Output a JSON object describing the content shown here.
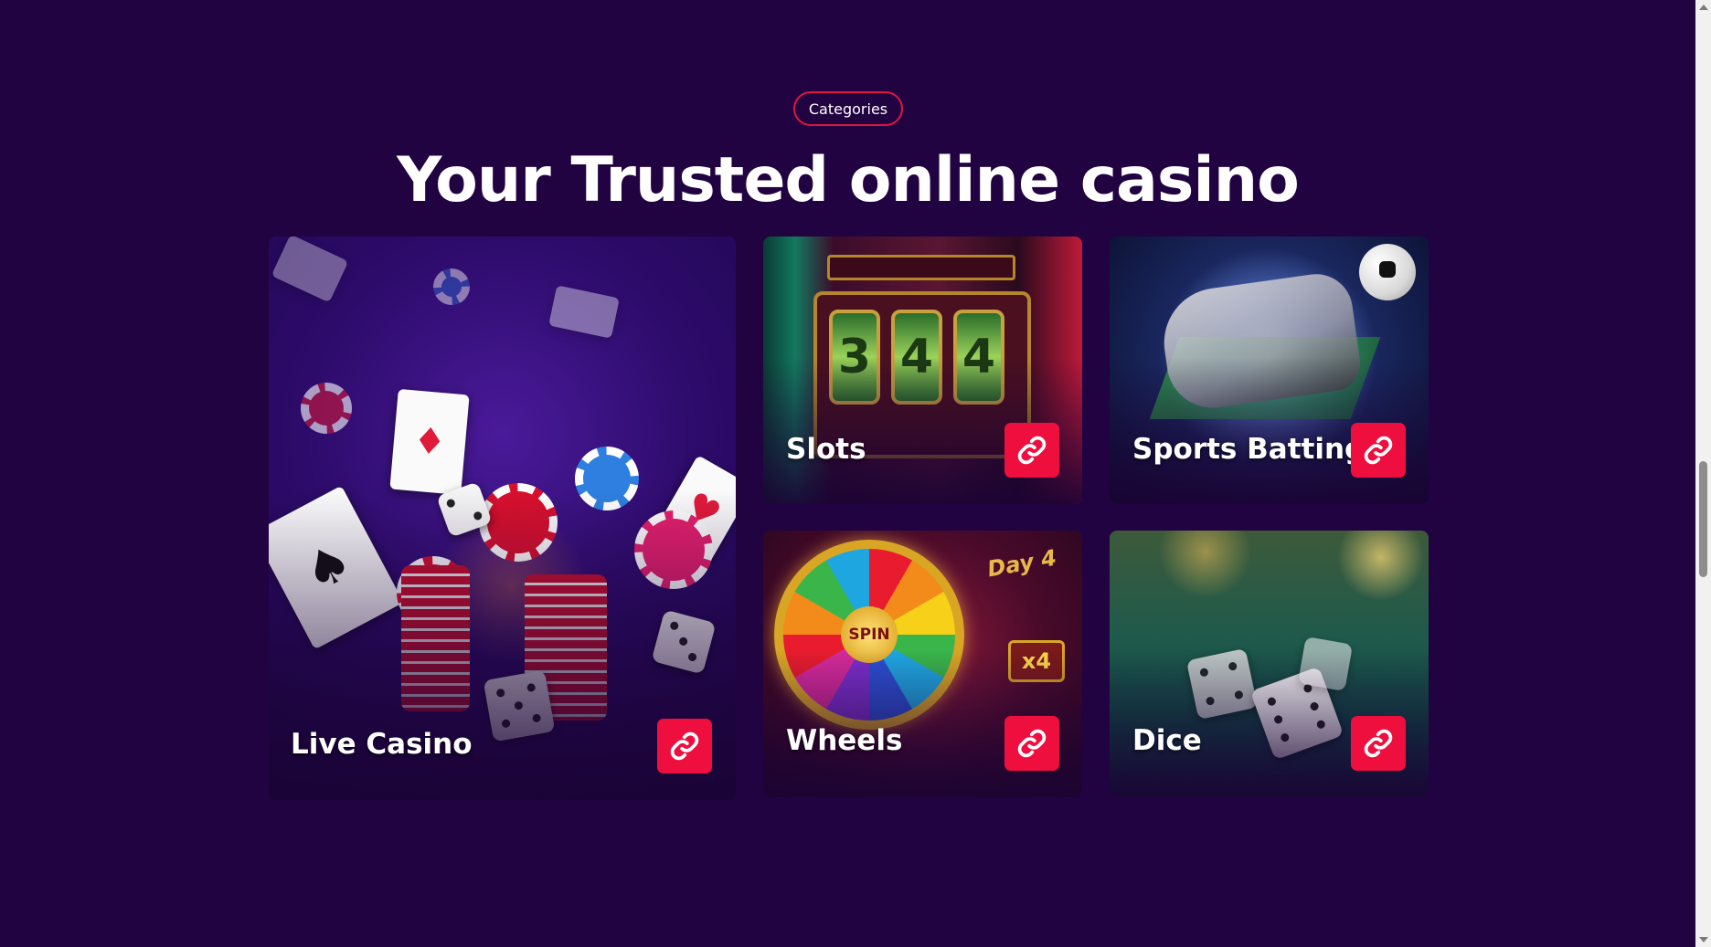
{
  "section": {
    "badge": "Categories",
    "heading": "Your Trusted online casino"
  },
  "categories": [
    {
      "label": "Live Casino",
      "icon": "link-icon"
    },
    {
      "label": "Slots",
      "icon": "link-icon"
    },
    {
      "label": "Sports Batting",
      "icon": "link-icon"
    },
    {
      "label": "Wheels",
      "icon": "link-icon"
    },
    {
      "label": "Dice",
      "icon": "link-icon"
    }
  ],
  "artwork": {
    "slots_reels": [
      "3",
      "4",
      "4"
    ],
    "wheel_hub": "SPIN",
    "wheel_badge": "Day 4",
    "wheel_multiplier": "x4"
  },
  "colors": {
    "background": "#220342",
    "accent": "#ee0f3f",
    "heading_text": "#ffffff"
  }
}
